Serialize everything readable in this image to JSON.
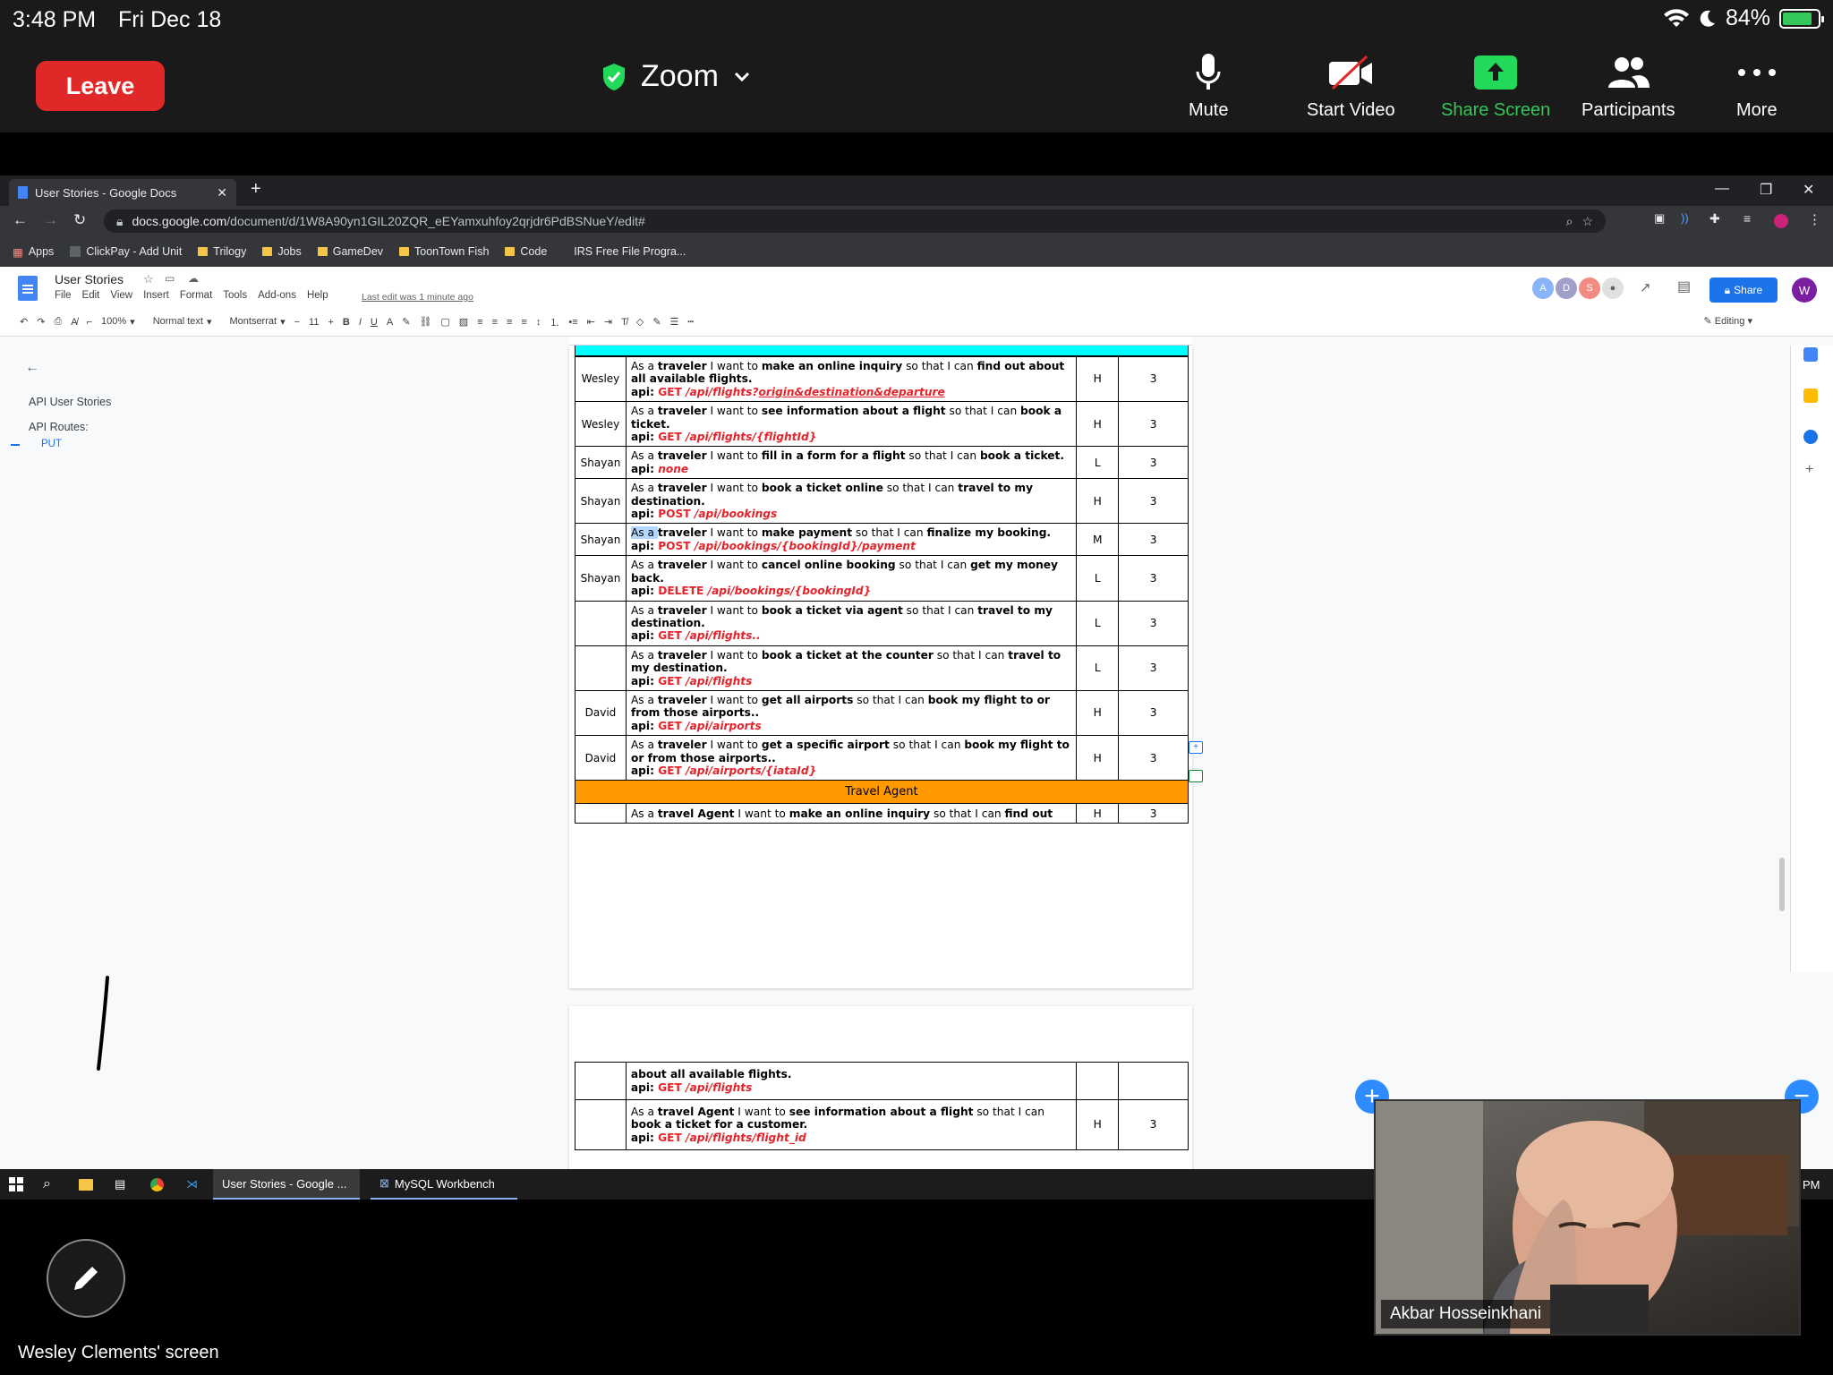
{
  "status_bar": {
    "time": "3:48 PM",
    "date": "Fri Dec 18",
    "battery": "84%"
  },
  "zoom": {
    "leave_label": "Leave",
    "title": "Zoom",
    "mute_label": "Mute",
    "start_video_label": "Start Video",
    "share_screen_label": "Share Screen",
    "participants_label": "Participants",
    "more_label": "More",
    "sharer_label": "Wesley Clements' screen",
    "video_name": "Akbar Hosseinkhani",
    "share_color": "#34c759",
    "leave_color": "#e02828"
  },
  "browser": {
    "tab_title": "User Stories - Google Docs",
    "url_host": "docs.google.com",
    "url_path": "/document/d/1W8A90yn1GIL20ZQR_eEYamxuhfoy2qrjdr6PdBSNueY/edit#",
    "bookmarks": [
      "Apps",
      "ClickPay - Add Unit",
      "Trilogy",
      "Jobs",
      "GameDev",
      "ToonTown Fish",
      "Code",
      "IRS Free File Progra..."
    ]
  },
  "docs": {
    "title": "User Stories",
    "menus": [
      "File",
      "Edit",
      "View",
      "Insert",
      "Format",
      "Tools",
      "Add-ons",
      "Help"
    ],
    "last_edit": "Last edit was 1 minute ago",
    "avatars": [
      "A",
      "D",
      "S"
    ],
    "share_label": "Share",
    "user_initial": "W",
    "toolbar": {
      "zoom": "100%",
      "style": "Normal text",
      "font": "Montserrat",
      "size": "11",
      "mode": "Editing"
    },
    "outline": {
      "items": [
        "API User Stories",
        "API Routes:"
      ],
      "sub": "PUT"
    }
  },
  "table": {
    "rows": [
      {
        "who": "Wesley",
        "pri": "H",
        "pts": "3",
        "p": [
          "As a ",
          "traveler",
          " I want to ",
          "make an online inquiry",
          " so that I can ",
          "find out about all available flights."
        ],
        "method": "GET",
        "route": " /api/flights?",
        "route_ext": "origin&destination&departure"
      },
      {
        "who": "Wesley",
        "pri": "H",
        "pts": "3",
        "p": [
          "As a ",
          "traveler",
          " I want to ",
          "see information about a flight",
          " so that I can ",
          "book a ticket."
        ],
        "method": "GET",
        "route": " /api/flights/{flightId}"
      },
      {
        "who": "Shayan",
        "pri": "L",
        "pts": "3",
        "p": [
          "As a ",
          "traveler",
          " I want to ",
          "fill in a form for a flight",
          " so that I can ",
          "book a ticket."
        ],
        "method": "",
        "route": "none"
      },
      {
        "who": "Shayan",
        "pri": "H",
        "pts": "3",
        "p": [
          "As a ",
          "traveler",
          " I want to ",
          "book a ticket online",
          " so that I can ",
          "travel to my destination."
        ],
        "method": "POST",
        "route": " /api/bookings"
      },
      {
        "who": "Shayan",
        "pri": "M",
        "pts": "3",
        "p": [
          "As a ",
          "traveler",
          " I want to ",
          "make payment",
          "  so that I can ",
          "finalize my booking."
        ],
        "method": "POST",
        "route": " /api/bookings/{bookingId}/payment"
      },
      {
        "who": "Shayan",
        "pri": "L",
        "pts": "3",
        "p": [
          "As a ",
          "traveler",
          " I want to ",
          "cancel online booking",
          " so that I can ",
          "get my money back."
        ],
        "method": "DELETE",
        "route": " /api/bookings/{bookingId}"
      },
      {
        "who": "",
        "pri": "L",
        "pts": "3",
        "p": [
          "As a ",
          "traveler",
          " I want to ",
          "book a ticket via agent",
          " so that I can ",
          "travel to my destination."
        ],
        "method": "GET",
        "route": " /api/flights.."
      },
      {
        "who": "",
        "pri": "L",
        "pts": "3",
        "p": [
          "As a ",
          "traveler",
          " I want to ",
          "book a ticket at the counter",
          " so that I can ",
          "travel to my destination."
        ],
        "method": "GET",
        "route": " /api/flights"
      },
      {
        "who": "David",
        "pri": "H",
        "pts": "3",
        "p": [
          "As a ",
          "traveler",
          " I want to ",
          "get all airports",
          " so that I can ",
          "book my flight to or from those airports.."
        ],
        "method": "GET",
        "route": " /api/airports"
      },
      {
        "who": "David",
        "pri": "H",
        "pts": "3",
        "p": [
          "As a ",
          "traveler",
          " I want to ",
          "get a specific airport",
          " so that I can ",
          "book my flight to or from those airports.."
        ],
        "method": "GET",
        "route": " /api/airports/{iataId}"
      }
    ],
    "band_label": "Travel Agent",
    "agent_row": {
      "p": [
        "As a ",
        "travel Agent",
        " I want to ",
        "make an online inquiry",
        " so that I can ",
        "find out"
      ],
      "pri": "H",
      "pts": "3"
    },
    "page2_rows": [
      {
        "text": "about all available flights.",
        "method": "GET",
        "route": " /api/flights",
        "pri": "",
        "pts": ""
      },
      {
        "p": [
          "As a ",
          "travel Agent",
          " I want to ",
          "see information about a flight",
          " so that I can ",
          "book a ticket for a customer."
        ],
        "method": "GET",
        "route": " /api/flights/flight_id",
        "pri": "H",
        "pts": "3"
      }
    ]
  },
  "taskbar": {
    "items": [
      "User Stories - Google ...",
      "MySQL Workbench"
    ],
    "clock": "PM"
  }
}
